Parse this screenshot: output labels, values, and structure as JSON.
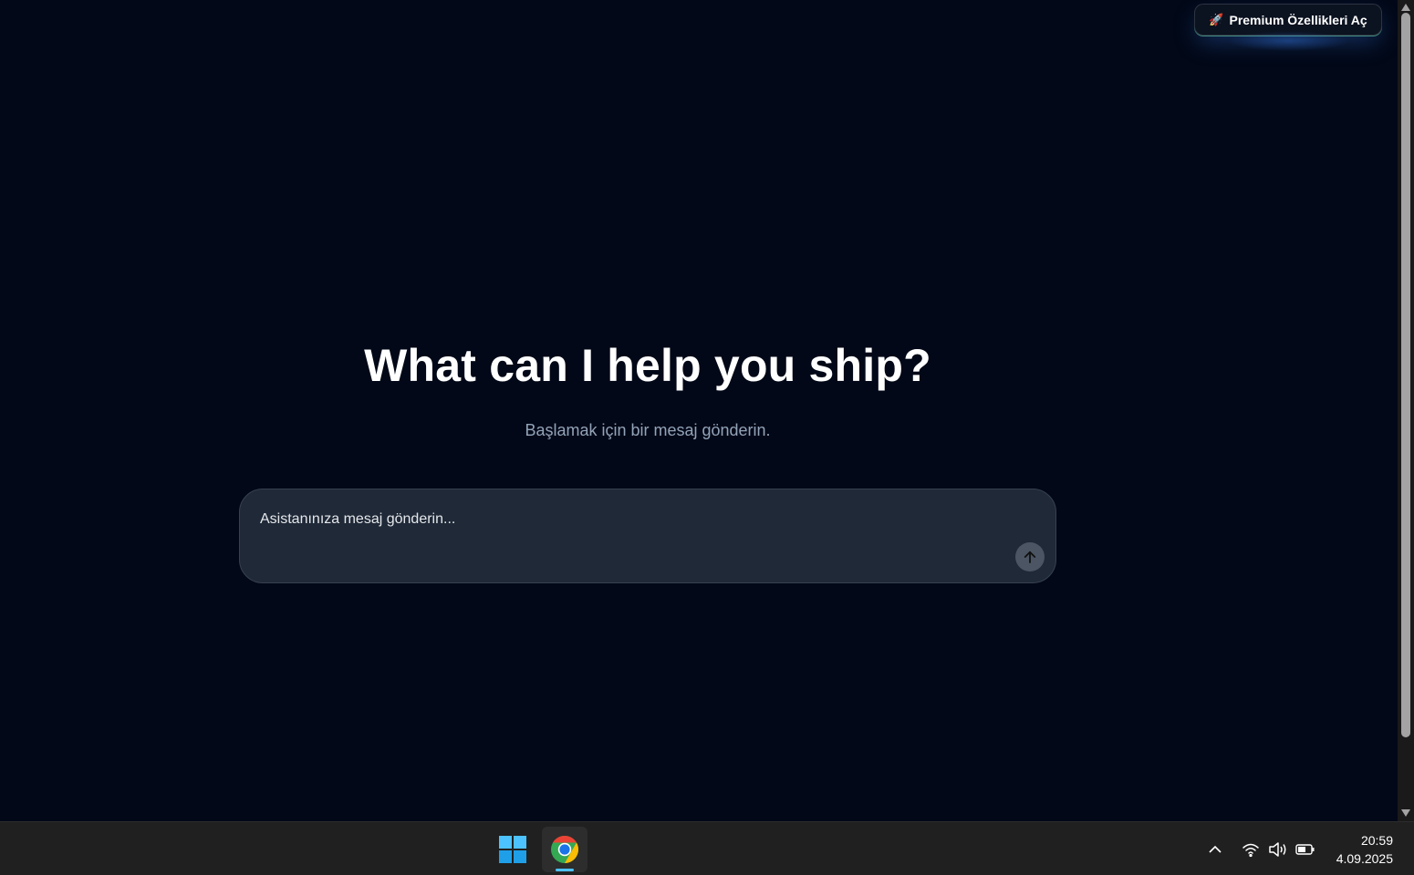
{
  "header": {
    "premium_button": {
      "icon": "rocket-icon",
      "label": "Premium Özellikleri Aç"
    }
  },
  "hero": {
    "title": "What can I help you ship?",
    "subtitle": "Başlamak için bir mesaj gönderin."
  },
  "composer": {
    "placeholder": "Asistanınıza mesaj gönderin...",
    "send_icon": "arrow-up-icon"
  },
  "colors": {
    "background": "#020817",
    "composer": "#1f2937",
    "subtitle": "#94a3b8",
    "taskbar": "#202020",
    "taskbar_accent": "#4cc2ff"
  },
  "taskbar": {
    "apps": [
      {
        "name": "windows-start-icon"
      },
      {
        "name": "chrome-icon",
        "active": true
      }
    ],
    "tray": [
      "chevron-up-icon",
      "wifi-icon",
      "speaker-icon",
      "battery-icon"
    ],
    "time": "20:59",
    "date": "4.09.2025"
  }
}
